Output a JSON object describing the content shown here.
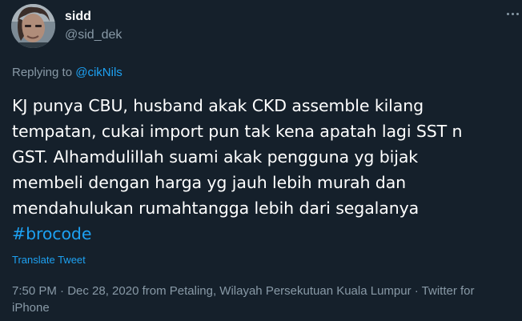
{
  "author": {
    "display_name": "sidd",
    "handle": "@sid_dek"
  },
  "reply": {
    "prefix": "Replying to ",
    "target": "@cikNils"
  },
  "tweet": {
    "lines": [
      "KJ punya CBU, husband akak CKD assemble kilang",
      "tempatan, cukai import pun tak kena apatah lagi SST n",
      "GST. Alhamdulillah suami akak pengguna yg bijak",
      "membeli dengan harga yg jauh lebih murah dan",
      "mendahulukan rumahtangga lebih dari segalanya"
    ],
    "hashtag": "#brocode"
  },
  "translate_label": "Translate Tweet",
  "meta": {
    "text": "7:50 PM · Dec 28, 2020 from Petaling, Wilayah Persekutuan Kuala Lumpur · Twitter for iPhone"
  },
  "icons": {
    "more": "more-horizontal-icon"
  },
  "colors": {
    "background": "#15202b",
    "accent": "#1da1f2",
    "secondary_text": "#8899a6"
  }
}
